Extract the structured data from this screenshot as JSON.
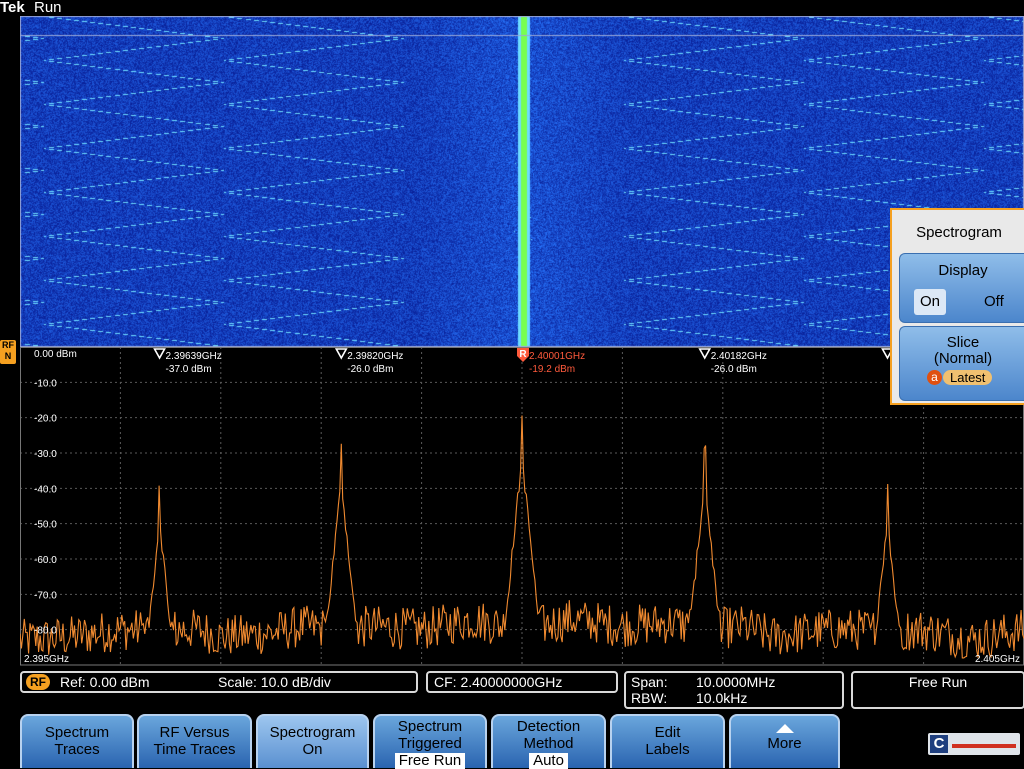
{
  "status": {
    "brand": "Tek",
    "run_state": "Run"
  },
  "rf_badge": {
    "line1": "RF",
    "line2": "N"
  },
  "plot": {
    "ref_level_label": "0.00 dBm",
    "y_tick_labels": [
      "-10.0",
      "-20.0",
      "-30.0",
      "-40.0",
      "-50.0",
      "-60.0",
      "-70.0",
      "-80.0"
    ],
    "x_start_label": "2.395GHz",
    "x_end_label": "2.405GHz",
    "markers": [
      {
        "symbol": "▽",
        "freq": "2.39639GHz",
        "amp": "-37.0 dBm",
        "color": "#ffffff"
      },
      {
        "symbol": "▽",
        "freq": "2.39820GHz",
        "amp": "-26.0 dBm",
        "color": "#ffffff"
      },
      {
        "symbol": "R",
        "freq": "2.40001GHz",
        "amp": "-19.2 dBm",
        "color": "#ff5a3c"
      },
      {
        "symbol": "▽",
        "freq": "2.40182GHz",
        "amp": "-26.0 dBm",
        "color": "#ffffff"
      },
      {
        "symbol": "▽",
        "freq": "",
        "amp": "",
        "color": "#ffffff"
      }
    ],
    "trace_color": "#f08a30",
    "grid_color": "#5a5a5a"
  },
  "chart_data": {
    "type": "line",
    "title": "",
    "xlabel": "",
    "ylabel": "",
    "xlim": [
      2.395,
      2.405
    ],
    "ylim": [
      -90,
      0
    ],
    "grid": true,
    "series": [
      {
        "x": [
          2.395,
          2.3955,
          2.396,
          2.39639,
          2.3968,
          2.397,
          2.3975,
          2.3978,
          2.3982,
          2.3985,
          2.399,
          2.3995,
          2.4,
          2.4005,
          2.401,
          2.4015,
          2.40182,
          2.4022,
          2.4025,
          2.403,
          2.40364,
          2.404,
          2.4045,
          2.405
        ],
        "values": [
          -83,
          -82,
          -80,
          -37,
          -80,
          -82,
          -81,
          -79,
          -26,
          -79,
          -80,
          -77,
          -19.2,
          -77,
          -79,
          -78,
          -26,
          -79,
          -82,
          -80,
          -37,
          -80,
          -83,
          -80
        ]
      }
    ]
  },
  "status_bar": {
    "rf_pill": "RF",
    "ref": "Ref: 0.00 dBm",
    "scale": "Scale: 10.0 dB/div",
    "cf": "CF:  2.40000000GHz",
    "span_label": "Span:",
    "span_value": "10.0000MHz",
    "rbw_label": "RBW:",
    "rbw_value": "10.0kHz",
    "trigger_mode": "Free Run"
  },
  "side_menu": {
    "title": "Spectrogram",
    "display_label": "Display",
    "display_on": "On",
    "display_off": "Off",
    "slice_label_1": "Slice",
    "slice_label_2": "(Normal)",
    "slice_knob": "a",
    "slice_value": "Latest"
  },
  "softkeys": {
    "spectrum_traces_1": "Spectrum",
    "spectrum_traces_2": "Traces",
    "rf_vs_time_1": "RF Versus",
    "rf_vs_time_2": "Time Traces",
    "spectrogram_1": "Spectrogram",
    "spectrogram_2": "On",
    "spectrum_trig_1": "Spectrum",
    "spectrum_trig_2": "Triggered",
    "spectrum_trig_3": "Free Run",
    "detection_1": "Detection",
    "detection_2": "Method",
    "detection_3": "Auto",
    "edit_labels_1": "Edit",
    "edit_labels_2": "Labels",
    "more": "More"
  },
  "logo": {
    "glyph": "C"
  }
}
